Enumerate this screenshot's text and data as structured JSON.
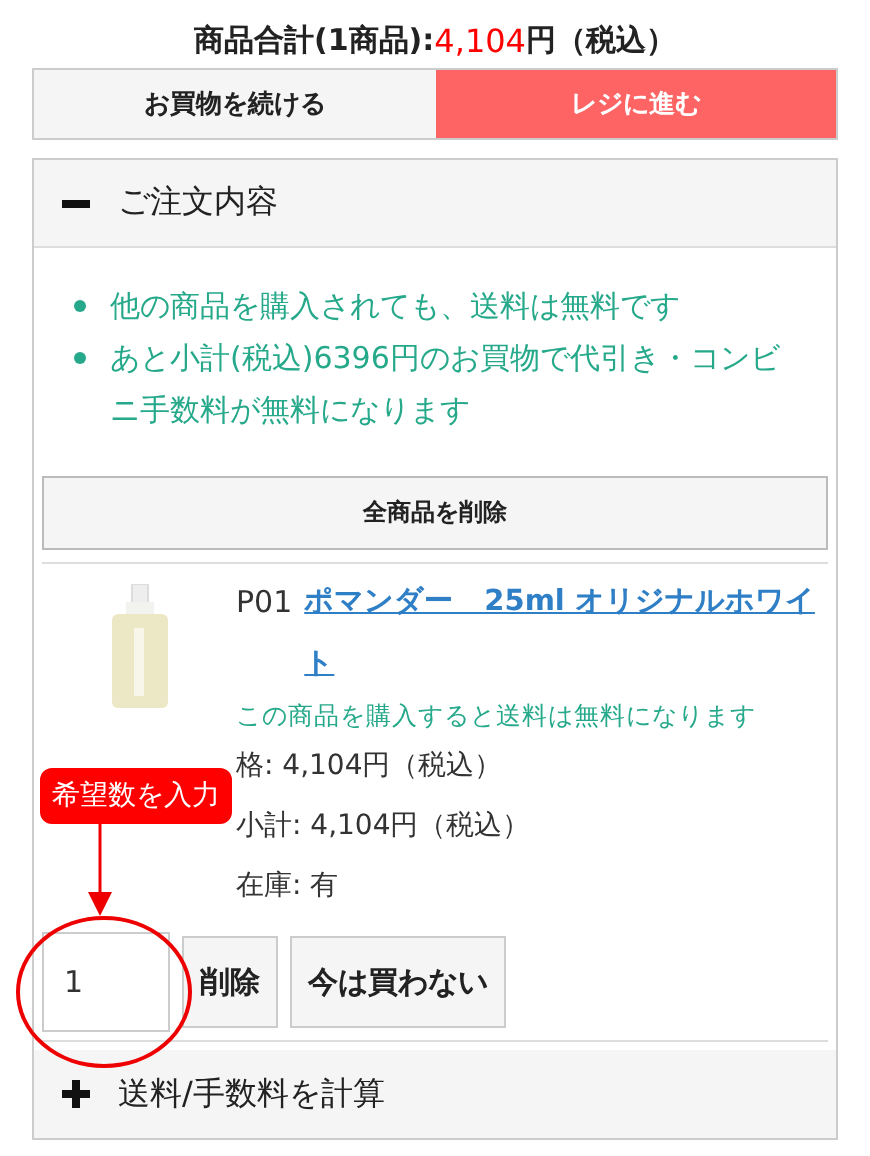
{
  "summary": {
    "label": "商品合計(1商品):",
    "amount": "4,104",
    "suffix": "円（税込）"
  },
  "actions": [
    {
      "label": "お買物を続ける",
      "kind": "secondary"
    },
    {
      "label": "レジに進む",
      "kind": "primary"
    }
  ],
  "order_panel": {
    "title": "ご注文内容",
    "expanded": true,
    "notices": [
      "他の商品を購入されても、送料は無料です",
      "あと小計(税込)6396円のお買物で代引き・コンビニ手数料が無料になります"
    ],
    "delete_all": "全商品を削除",
    "item": {
      "code": "P01",
      "name": "ポマンダー　25ml オリジナルホワイト",
      "note": "この商品を購入すると送料は無料になります",
      "price": "格: 4,104円（税込）",
      "subtotal": "小計: 4,104円（税込）",
      "stock": "在庫: 有",
      "quantity": "1",
      "buttons": [
        "削除",
        "今は買わない"
      ]
    },
    "callout": "希望数を入力"
  },
  "shipping_panel": {
    "title": "送料/手数料を計算",
    "expanded": false
  }
}
